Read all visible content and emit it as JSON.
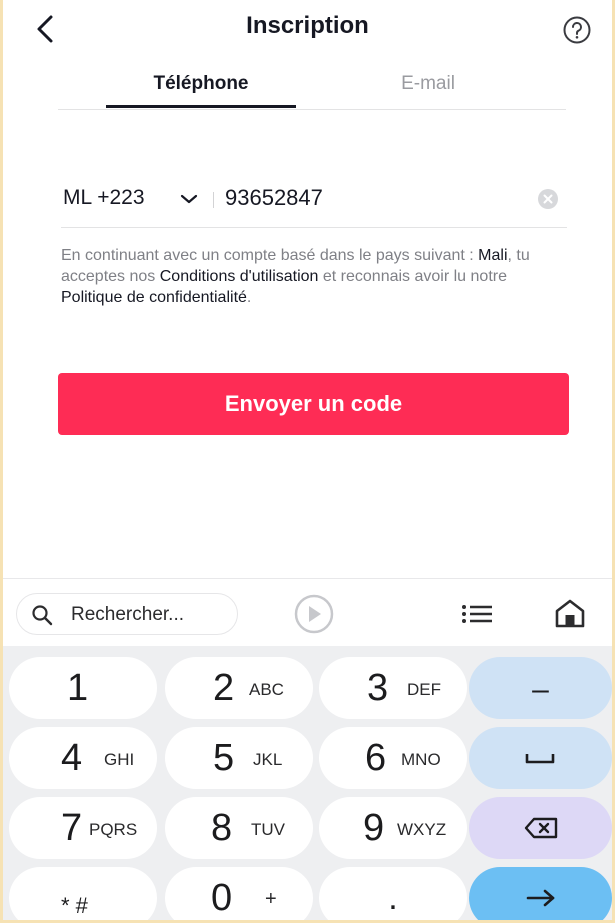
{
  "header": {
    "title": "Inscription"
  },
  "tabs": [
    {
      "label": "Téléphone",
      "active": true
    },
    {
      "label": "E-mail",
      "active": false
    }
  ],
  "phone": {
    "country_code": "ML +223",
    "number": "93652847"
  },
  "legal": {
    "part1": "En continuant avec un compte basé dans le pays suivant : ",
    "country": "Mali",
    "part2": ", tu acceptes nos ",
    "terms_link": "Conditions d'utilisation",
    "part3": " et reconnais avoir lu notre ",
    "privacy_link": "Politique de confidentialité",
    "part4": "."
  },
  "send_button": {
    "label": "Envoyer un code",
    "color": "#fe2c55"
  },
  "keyboard_toolbar": {
    "search_placeholder": "Rechercher...",
    "icons": [
      "search-icon",
      "play-icon",
      "list-icon",
      "home-icon"
    ]
  },
  "keypad": {
    "rows": [
      [
        {
          "digit": "1",
          "letters": ""
        },
        {
          "digit": "2",
          "letters": "ABC"
        },
        {
          "digit": "3",
          "letters": "DEF"
        },
        {
          "symbol": "–"
        }
      ],
      [
        {
          "digit": "4",
          "letters": "GHI"
        },
        {
          "digit": "5",
          "letters": "JKL"
        },
        {
          "digit": "6",
          "letters": "MNO"
        },
        {
          "icon": "space-icon"
        }
      ],
      [
        {
          "digit": "7",
          "letters": "PQRS"
        },
        {
          "digit": "8",
          "letters": "TUV"
        },
        {
          "digit": "9",
          "letters": "WXYZ"
        },
        {
          "icon": "backspace-icon"
        }
      ],
      [
        {
          "digit": "* #",
          "letters": ""
        },
        {
          "digit": "0",
          "letters": "+"
        },
        {
          "digit": ".",
          "letters": ""
        },
        {
          "icon": "enter-arrow-icon"
        }
      ]
    ]
  },
  "colors": {
    "accent": "#fe2c55",
    "key_blue": "#cfe2f5",
    "key_purple": "#ddd8f6",
    "key_enter": "#6cbff3",
    "frame": "#f6e2b4"
  }
}
